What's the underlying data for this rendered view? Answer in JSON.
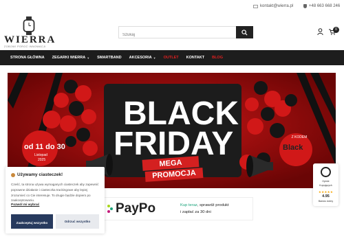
{
  "topbar": {
    "email": "kontakt@wierra.pl",
    "phone": "+48 663 668 246"
  },
  "header": {
    "logo_text": "WIERRA",
    "tagline": "ZOBOWI POROĆ INNOWACJI",
    "search_placeholder": "Szukaj",
    "cart_count": "0"
  },
  "nav": {
    "items": [
      {
        "label": "STRONA GŁÓWNA"
      },
      {
        "label": "ZEGARKI WIERRA"
      },
      {
        "label": "SMARTBAND"
      },
      {
        "label": "AKCESORIA"
      },
      {
        "label": "OUTLET"
      },
      {
        "label": "KONTAKT"
      },
      {
        "label": "BLOG"
      }
    ]
  },
  "hero": {
    "title_line1": "BLACK",
    "title_line2": "FRIDAY",
    "badge_top": "MEGA",
    "badge_bottom": "PROMOCJA",
    "date_main": "od 11 do 30",
    "date_month": "Listopad",
    "date_year": "2025",
    "code_label": "Z KODEM",
    "code_value": "Black"
  },
  "paypo": {
    "logo": "PayPo",
    "accent_text": "Kup teraz",
    "text_line1_rest": ", sprawdź produkt",
    "text_line2": "i zapłać za 30 dni"
  },
  "cookie": {
    "title": "Używamy ciasteczek!",
    "body": "Cześć, ta strona używa wymaganych ciasteczek aby zapewnić poprawne działanie i ciasteczka trackingowe aby lepiej zrozumieć co Cie interesuje. To drugie będzie dopiero po zaakceptowaniu.",
    "link": "Pozwól mi wybrać",
    "accept": "Zaakceptuj wszystko",
    "reject": "Odrzuć wszystko"
  },
  "trust": {
    "label_line1": "Opinie",
    "label_line2": "Kupujących",
    "stars": "★★★★★",
    "score": "4.95",
    "rating": "Bardzo dobry"
  },
  "colors": {
    "nav_bg": "#1d1d1d",
    "outlet": "#e02020",
    "banner": "#8c0606",
    "cookie_accept": "#273a5e",
    "paypo_accent": "#1aa37a"
  }
}
